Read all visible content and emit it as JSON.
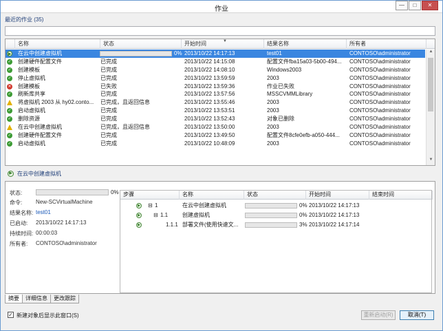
{
  "window": {
    "title": "作业",
    "minimize": "—",
    "maximize": "□",
    "close": "✕"
  },
  "recent_label": "最近的作业 (35)",
  "search": {
    "placeholder": ""
  },
  "columns": [
    "名称",
    "状态",
    "开始时间",
    "结果名称",
    "所有者"
  ],
  "jobs": [
    {
      "icon": "running-icon",
      "name": "在云中创建虚拟机",
      "status": "",
      "percent": "0%",
      "progress": 0.0,
      "start": "2013/10/22 14:17:13",
      "result": "test01",
      "owner": "CONTOSO\\administrator",
      "selected": true
    },
    {
      "icon": "completed-icon",
      "name": "创建硬件配置文件",
      "status": "已完成",
      "start": "2013/10/22 14:15:08",
      "result": "配置文件fba15a03-5b00-494...",
      "owner": "CONTOSO\\administrator"
    },
    {
      "icon": "completed-icon",
      "name": "创建模板",
      "status": "已完成",
      "start": "2013/10/22 14:08:10",
      "result": "Windows2003",
      "owner": "CONTOSO\\administrator"
    },
    {
      "icon": "completed-icon",
      "name": "停止虚拟机",
      "status": "已完成",
      "start": "2013/10/22 13:59:59",
      "result": "2003",
      "owner": "CONTOSO\\administrator"
    },
    {
      "icon": "failed-icon",
      "name": "创建模板",
      "status": "已失败",
      "start": "2013/10/22 13:59:36",
      "result": "作业已失败",
      "owner": "CONTOSO\\administrator"
    },
    {
      "icon": "completed-icon",
      "name": "刷新库共享",
      "status": "已完成",
      "start": "2013/10/22 13:57:56",
      "result": "MSSCVMMLibrary",
      "owner": "CONTOSO\\administrator"
    },
    {
      "icon": "warning-icon",
      "name": "将虚拟机 2003 从 hy02.conto...",
      "status": "已完成，且返回信息",
      "start": "2013/10/22 13:55:46",
      "result": "2003",
      "owner": "CONTOSO\\administrator"
    },
    {
      "icon": "completed-icon",
      "name": "启动虚拟机",
      "status": "已完成",
      "start": "2013/10/22 13:53:51",
      "result": "2003",
      "owner": "CONTOSO\\administrator"
    },
    {
      "icon": "completed-icon",
      "name": "删除资源",
      "status": "已完成",
      "start": "2013/10/22 13:52:43",
      "result": "对象已删除",
      "owner": "CONTOSO\\administrator"
    },
    {
      "icon": "warning-icon",
      "name": "在云中创建虚拟机",
      "status": "已完成，且返回信息",
      "start": "2013/10/22 13:50:00",
      "result": "2003",
      "owner": "CONTOSO\\administrator"
    },
    {
      "icon": "completed-icon",
      "name": "创建硬件配置文件",
      "status": "已完成",
      "start": "2013/10/22 13:49:50",
      "result": "配置文件8cfe0efb-a050-444...",
      "owner": "CONTOSO\\administrator"
    },
    {
      "icon": "completed-icon",
      "name": "启动虚拟机",
      "status": "已完成",
      "start": "2013/10/22 10:48:09",
      "result": "2003",
      "owner": "CONTOSO\\administrator"
    }
  ],
  "selected_job": "在云中创建虚拟机",
  "details": {
    "status_label": "状态:",
    "status_percent": "0%",
    "status_progress": 0.0,
    "command_label": "命令:",
    "command": "New-SCVirtualMachine",
    "result_label": "结果名称:",
    "result": "test01",
    "started_label": "已启动:",
    "started": "2013/10/22 14:17:13",
    "duration_label": "持续时间:",
    "duration": "00:00:03",
    "owner_label": "所有者:",
    "owner": "CONTOSO\\administrator"
  },
  "step_columns": [
    "步骤",
    "名称",
    "状态",
    "开始时间",
    "结束时间"
  ],
  "steps": [
    {
      "expand": "⊟",
      "step": "1",
      "name": "在云中创建虚拟机",
      "percent": "0%",
      "progress": 0.0,
      "start": "2013/10/22 14:17:13",
      "end": ""
    },
    {
      "expand": "⊟",
      "step": "1.1",
      "name": "创建虚拟机",
      "percent": "0%",
      "progress": 0.0,
      "start": "2013/10/22 14:17:13",
      "end": ""
    },
    {
      "expand": "",
      "step": "1.1.1",
      "name": "部署文件(使用快速文...",
      "percent": "3%",
      "progress": 0.03,
      "start": "2013/10/22 14:17:14",
      "end": ""
    }
  ],
  "tabs": [
    "摘要",
    "详细信息",
    "更改跟踪"
  ],
  "footer": {
    "checkbox_label": "新建对象后显示此窗口(S)",
    "checked": true,
    "restart": "重新启动(R)",
    "cancel": "取消(T)"
  }
}
